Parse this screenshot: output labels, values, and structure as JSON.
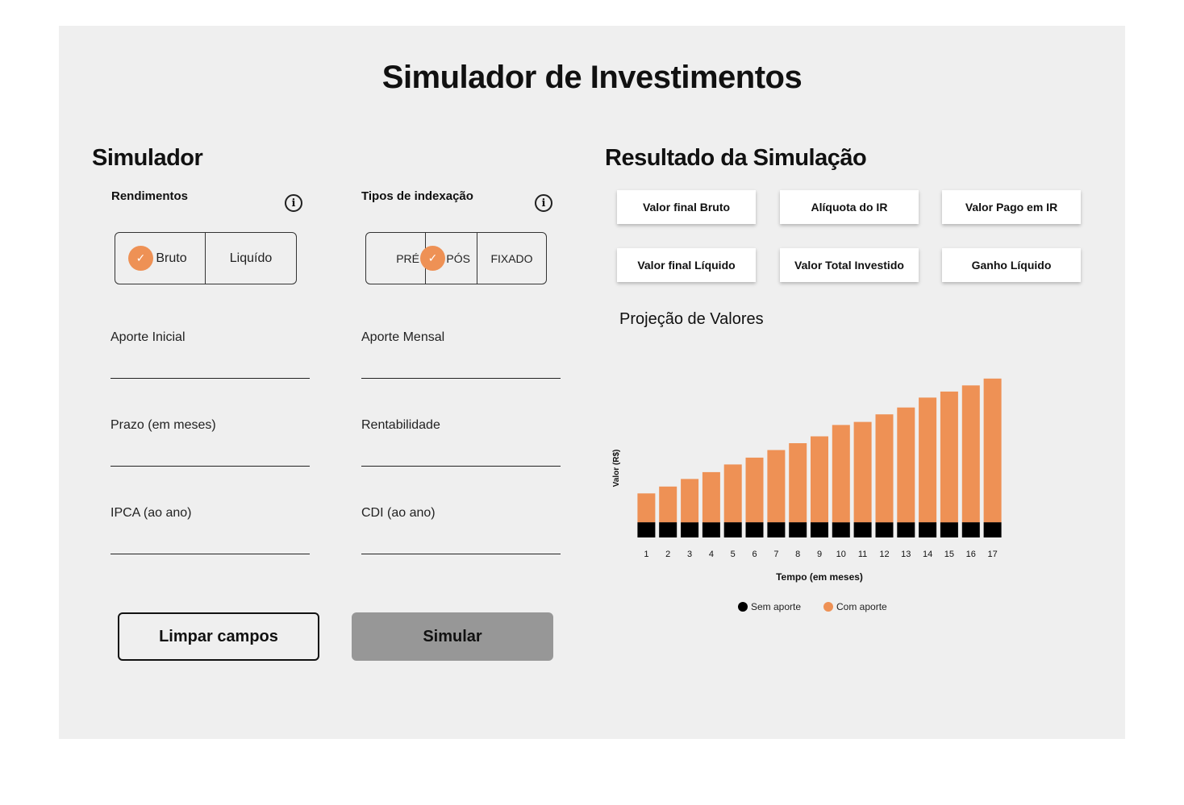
{
  "header": {
    "title": "Simulador de Investimentos"
  },
  "simulator": {
    "title": "Simulador",
    "rendimentos": {
      "label": "Rendimentos",
      "options": [
        "Bruto",
        "Liquído"
      ],
      "selected": "Bruto"
    },
    "indexacao": {
      "label": "Tipos de indexação",
      "options": [
        "PRÉ",
        "PÓS",
        "FIXADO"
      ],
      "selected": "PÓS"
    },
    "info_icon": "i",
    "check_icon": "✓",
    "fields": {
      "aporte_inicial": {
        "label": "Aporte Inicial",
        "value": ""
      },
      "aporte_mensal": {
        "label": "Aporte Mensal",
        "value": ""
      },
      "prazo": {
        "label": "Prazo (em meses)",
        "value": ""
      },
      "rentabilidade": {
        "label": "Rentabilidade",
        "value": ""
      },
      "ipca": {
        "label": "IPCA (ao ano)",
        "value": ""
      },
      "cdi": {
        "label": "CDI (ao ano)",
        "value": ""
      }
    },
    "buttons": {
      "clear": "Limpar campos",
      "simulate": "Simular"
    }
  },
  "results": {
    "title": "Resultado da Simulação",
    "cards": [
      "Valor final Bruto",
      "Alíquota do IR",
      "Valor Pago em IR",
      "Valor final Líquido",
      "Valor Total Investido",
      "Ganho Líquido"
    ]
  },
  "colors": {
    "accent": "#ee9155",
    "dark": "#000000",
    "panel": "#efefef",
    "button_disabled": "#979797"
  },
  "chart_data": {
    "type": "bar",
    "stacked": true,
    "title": "Projeção de Valores",
    "xlabel": "Tempo (em meses)",
    "ylabel": "Valor (R$)",
    "categories": [
      "1",
      "2",
      "3",
      "4",
      "5",
      "6",
      "7",
      "8",
      "9",
      "10",
      "11",
      "12",
      "13",
      "14",
      "15",
      "16",
      "17"
    ],
    "series": [
      {
        "name": "Sem aporte",
        "color": "#000000",
        "values": [
          20,
          20,
          20,
          20,
          20,
          20,
          20,
          20,
          20,
          20,
          20,
          20,
          20,
          20,
          20,
          20,
          20
        ]
      },
      {
        "name": "Com aporte",
        "color": "#ee9155",
        "values": [
          38,
          47,
          57,
          66,
          76,
          85,
          95,
          104,
          113,
          128,
          132,
          142,
          151,
          164,
          172,
          180,
          189
        ]
      }
    ],
    "ylim": [
      0,
      212
    ],
    "grid": false,
    "legend": "bottom"
  }
}
